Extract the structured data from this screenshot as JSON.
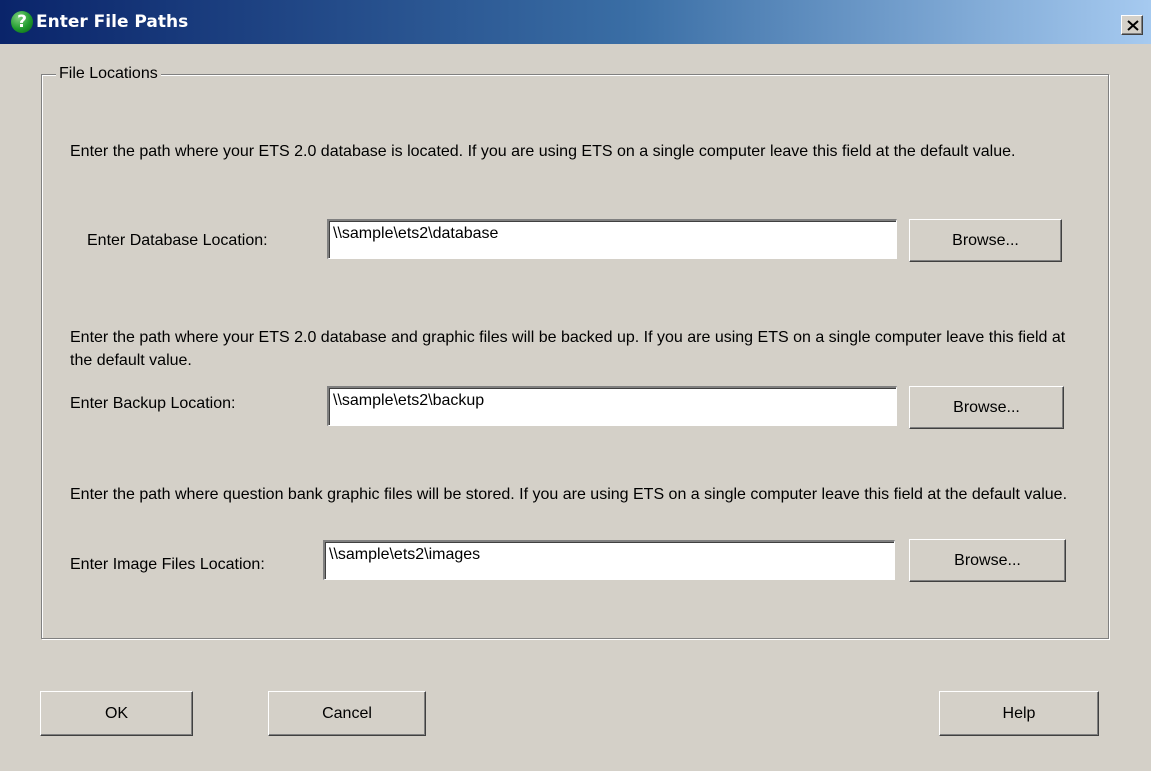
{
  "window": {
    "title": "Enter File Paths",
    "icon": "question-icon",
    "close_glyph": "x-icon",
    "colors": {
      "titlebar_start": "#0a246a",
      "titlebar_end": "#a6caf0",
      "face": "#d4d0c8"
    }
  },
  "group": {
    "legend": "File Locations"
  },
  "database": {
    "description": "Enter the path where your ETS 2.0 database is located. If you are using ETS on a single computer leave this field at the default value.",
    "label": "Enter Database Location:",
    "value": "\\\\sample\\ets2\\database",
    "browse_label": "Browse..."
  },
  "backup": {
    "description": "Enter the path where your ETS 2.0 database and graphic files will be backed up.  If you are using ETS on a single computer leave this field at the default value.",
    "label": "Enter Backup Location:",
    "value": "\\\\sample\\ets2\\backup",
    "browse_label": "Browse..."
  },
  "images": {
    "description": "Enter the path where question bank graphic files will be stored.  If you are using ETS on a single computer leave this field at the default value.",
    "label": "Enter Image Files Location:",
    "value": "\\\\sample\\ets2\\images",
    "browse_label": "Browse..."
  },
  "footer": {
    "ok_label": "OK",
    "cancel_label": "Cancel",
    "help_label": "Help"
  }
}
